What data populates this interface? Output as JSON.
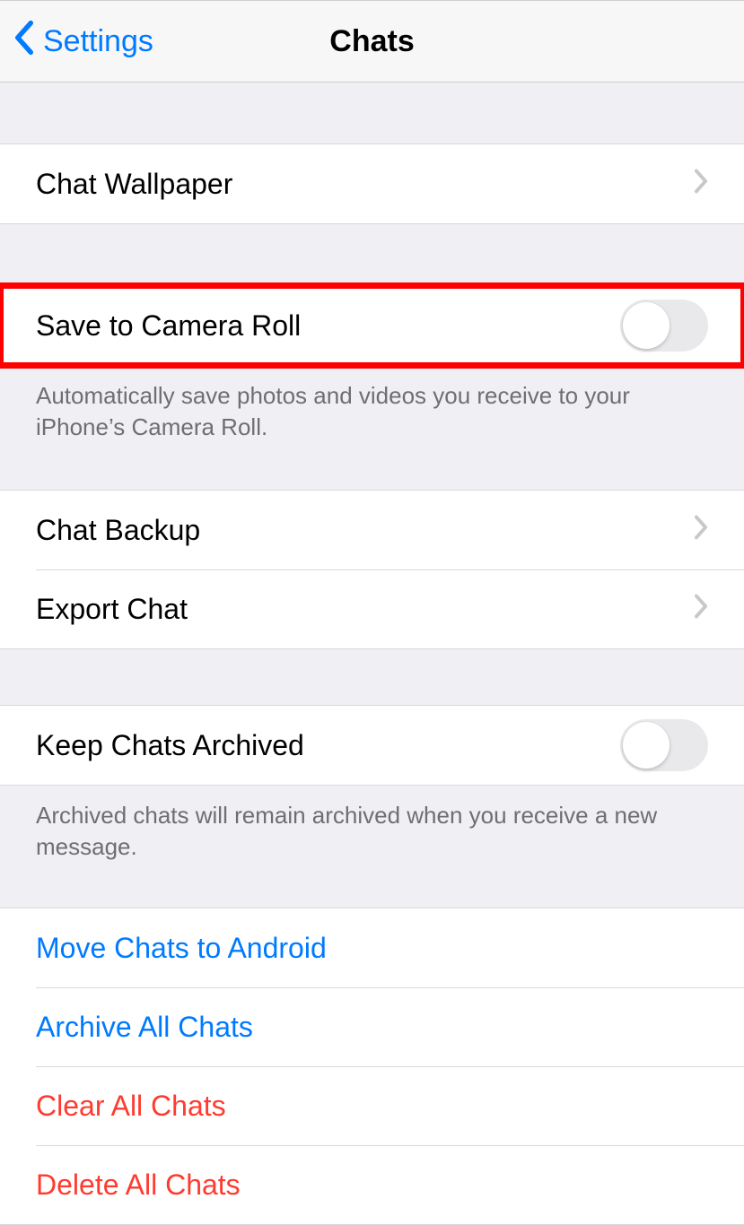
{
  "header": {
    "back_label": "Settings",
    "title": "Chats"
  },
  "wallpaper": {
    "label": "Chat Wallpaper"
  },
  "camera_roll": {
    "label": "Save to Camera Roll",
    "on": false,
    "footer": "Automatically save photos and videos you receive to your iPhone’s Camera Roll."
  },
  "backup": {
    "backup_label": "Chat Backup",
    "export_label": "Export Chat"
  },
  "archive": {
    "label": "Keep Chats Archived",
    "on": false,
    "footer": "Archived chats will remain archived when you receive a new message."
  },
  "actions": {
    "move": "Move Chats to Android",
    "archive_all": "Archive All Chats",
    "clear_all": "Clear All Chats",
    "delete_all": "Delete All Chats"
  }
}
